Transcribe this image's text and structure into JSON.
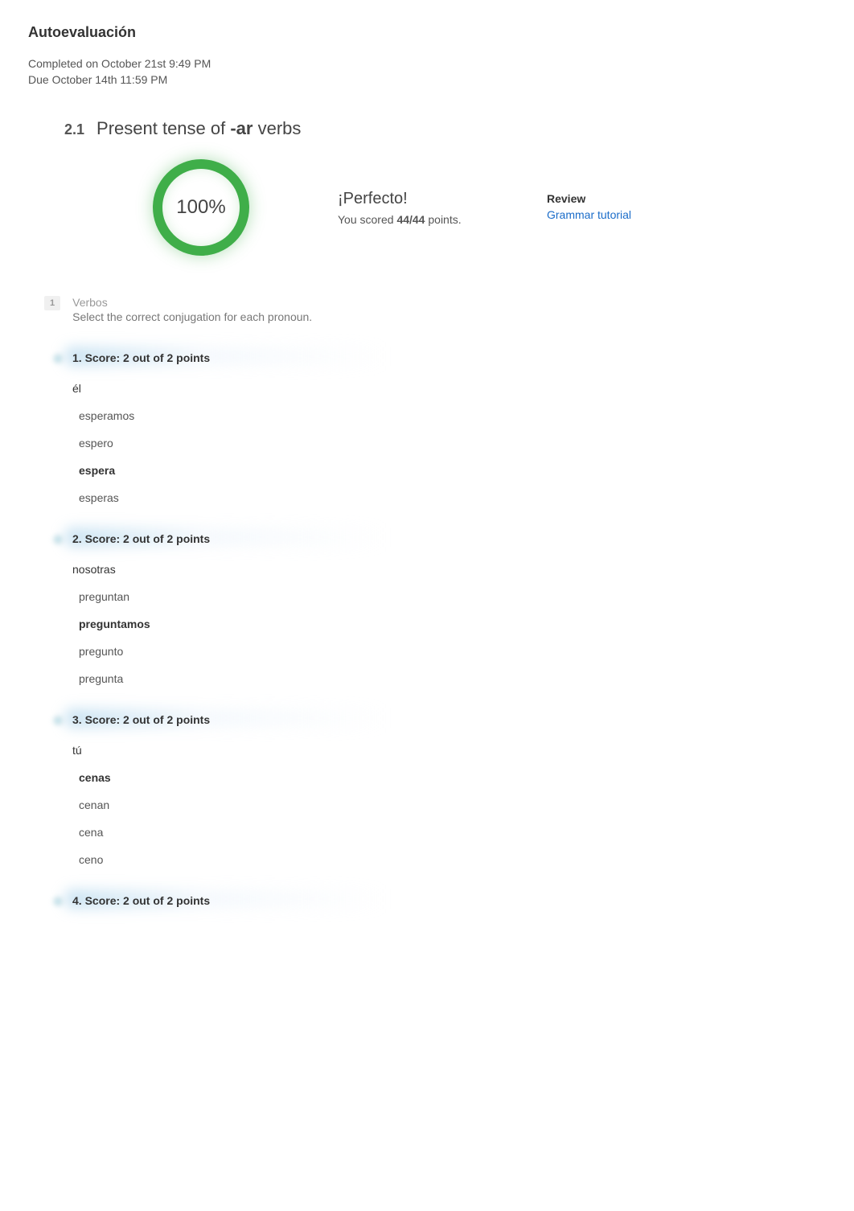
{
  "page": {
    "title": "Autoevaluación",
    "completed": "Completed on October 21st 9:49 PM",
    "due": "Due October 14th 11:59 PM"
  },
  "section": {
    "number": "2.1",
    "title_pre": "Present tense of ",
    "title_bold": "-ar",
    "title_post": " verbs"
  },
  "score": {
    "percent": "100%",
    "headline": "¡Perfecto!",
    "points_pre": "You scored ",
    "points_bold": "44/44",
    "points_post": " points."
  },
  "review": {
    "label": "Review",
    "link_text": "Grammar tutorial"
  },
  "group": {
    "badge": "1",
    "name": "Verbos",
    "desc": "Select the correct conjugation for each pronoun."
  },
  "questions": [
    {
      "score": "1.  Score: 2 out of 2 points",
      "pronoun": "él",
      "options": [
        {
          "text": "esperamos",
          "correct": false
        },
        {
          "text": "espero",
          "correct": false
        },
        {
          "text": "espera",
          "correct": true
        },
        {
          "text": "esperas",
          "correct": false
        }
      ]
    },
    {
      "score": "2.  Score: 2 out of 2 points",
      "pronoun": "nosotras",
      "options": [
        {
          "text": "preguntan",
          "correct": false
        },
        {
          "text": "preguntamos",
          "correct": true
        },
        {
          "text": "pregunto",
          "correct": false
        },
        {
          "text": "pregunta",
          "correct": false
        }
      ]
    },
    {
      "score": "3.  Score: 2 out of 2 points",
      "pronoun": "tú",
      "options": [
        {
          "text": "cenas",
          "correct": true
        },
        {
          "text": "cenan",
          "correct": false
        },
        {
          "text": "cena",
          "correct": false
        },
        {
          "text": "ceno",
          "correct": false
        }
      ]
    },
    {
      "score": "4.  Score: 2 out of 2 points",
      "pronoun": "",
      "options": []
    }
  ]
}
